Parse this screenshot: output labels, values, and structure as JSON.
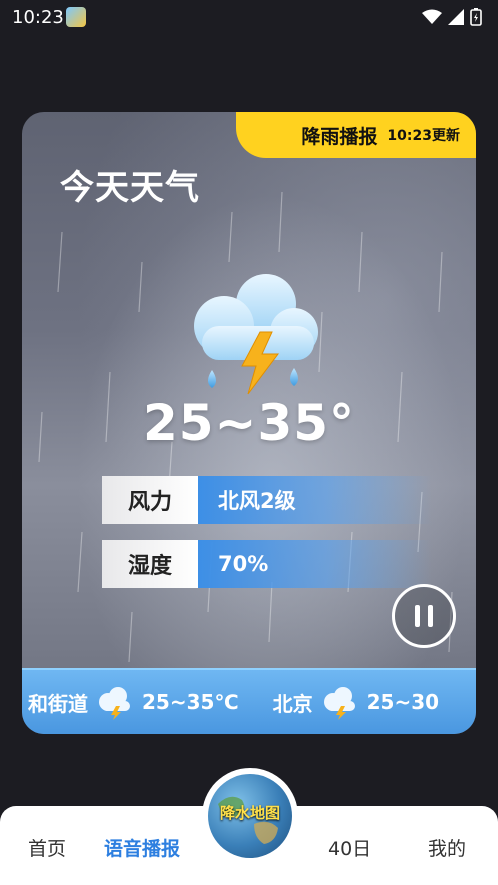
{
  "status_bar": {
    "time": "10:23"
  },
  "card": {
    "badge_title": "降雨播报",
    "badge_time": "10:23更新",
    "title": "今天天气",
    "temperature": "25~35°",
    "wind_label": "风力",
    "wind_value": "北风2级",
    "humidity_label": "湿度",
    "humidity_value": "70%",
    "ticker": [
      {
        "place": "和街道",
        "temp": "25~35℃"
      },
      {
        "place": "北京",
        "temp": "25~30"
      }
    ]
  },
  "nav": {
    "home": "首页",
    "voice": "语音播报",
    "map": "降水地图",
    "forty_day": "40日",
    "mine": "我的"
  },
  "colors": {
    "accent": "#2d7fe0",
    "badge": "#ffd21f"
  }
}
